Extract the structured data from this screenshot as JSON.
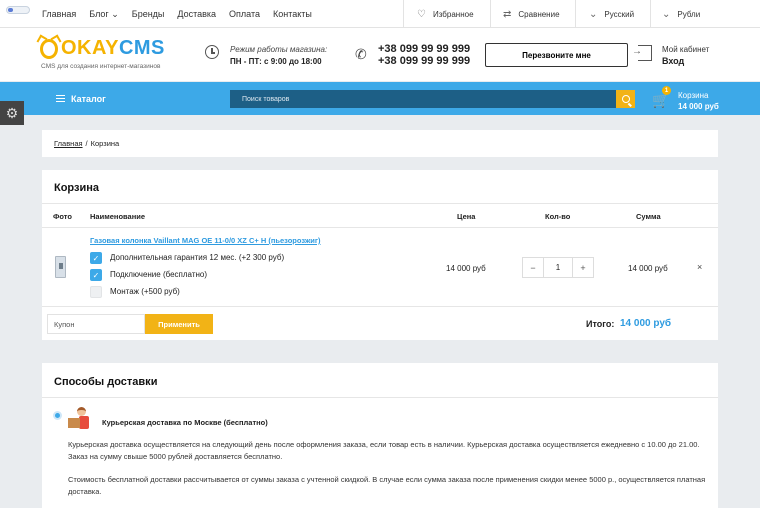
{
  "topbar": {
    "nav": [
      "Главная",
      "Блог",
      "Бренды",
      "Доставка",
      "Оплата",
      "Контакты"
    ],
    "favorites": "Избранное",
    "compare": "Сравнение",
    "language": "Русский",
    "currency": "Рубли"
  },
  "header": {
    "logo_okay": "OKAY",
    "logo_cms": "CMS",
    "logo_sub": "CMS для создания интернет-магазинов",
    "hours_label": "Режим работы магазина:",
    "hours_value": "ПН - ПТ: с 9:00 до 18:00",
    "phones": [
      "+38 099 99 99 999",
      "+38 099 99 99 999"
    ],
    "callback": "Перезвоните мне",
    "cabinet_label": "Мой кабинет",
    "cabinet_login": "Вход"
  },
  "navbar": {
    "catalog": "Каталог",
    "search_placeholder": "Поиск товаров",
    "cart_count": "1",
    "cart_label": "Корзина",
    "cart_total": "14 000 руб"
  },
  "breadcrumb": {
    "home": "Главная",
    "sep": "/",
    "current": "Корзина"
  },
  "cart": {
    "title": "Корзина",
    "headers": {
      "photo": "Фото",
      "name": "Наименование",
      "price": "Цена",
      "qty": "Кол-во",
      "sum": "Сумма"
    },
    "item": {
      "name": "Газовая колонка Vaillant MAG OE 11-0/0 XZ C+ H (пьезорозжиг)",
      "options": [
        {
          "label": "Дополнительная гарантия 12 мес. (+2 300 руб)",
          "checked": true
        },
        {
          "label": "Подключение (бесплатно)",
          "checked": true
        },
        {
          "label": "Монтаж (+500 руб)",
          "checked": false
        }
      ],
      "price": "14 000 руб",
      "qty": "1",
      "minus": "−",
      "plus": "+",
      "sum": "14 000 руб",
      "remove": "×"
    },
    "coupon_placeholder": "Купон",
    "apply": "Применить",
    "total_label": "Итого:",
    "total_value": "14 000 руб"
  },
  "delivery": {
    "title": "Способы доставки",
    "method_name": "Курьерская доставка по Москве (бесплатно)",
    "text1": "Курьерская доставка осуществляется на следующий день после оформления заказа, если товар есть в наличии. Курьерская доставка осуществляется ежедневно с 10.00 до 21.00. Заказ на сумму свыше 5000 рублей доставляется бесплатно.",
    "text2": "Стоимость бесплатной доставки рассчитывается от суммы заказа с учтенной скидкой. В случае если сумма заказа после применения скидки менее 5000 р., осуществляется платная доставка."
  }
}
